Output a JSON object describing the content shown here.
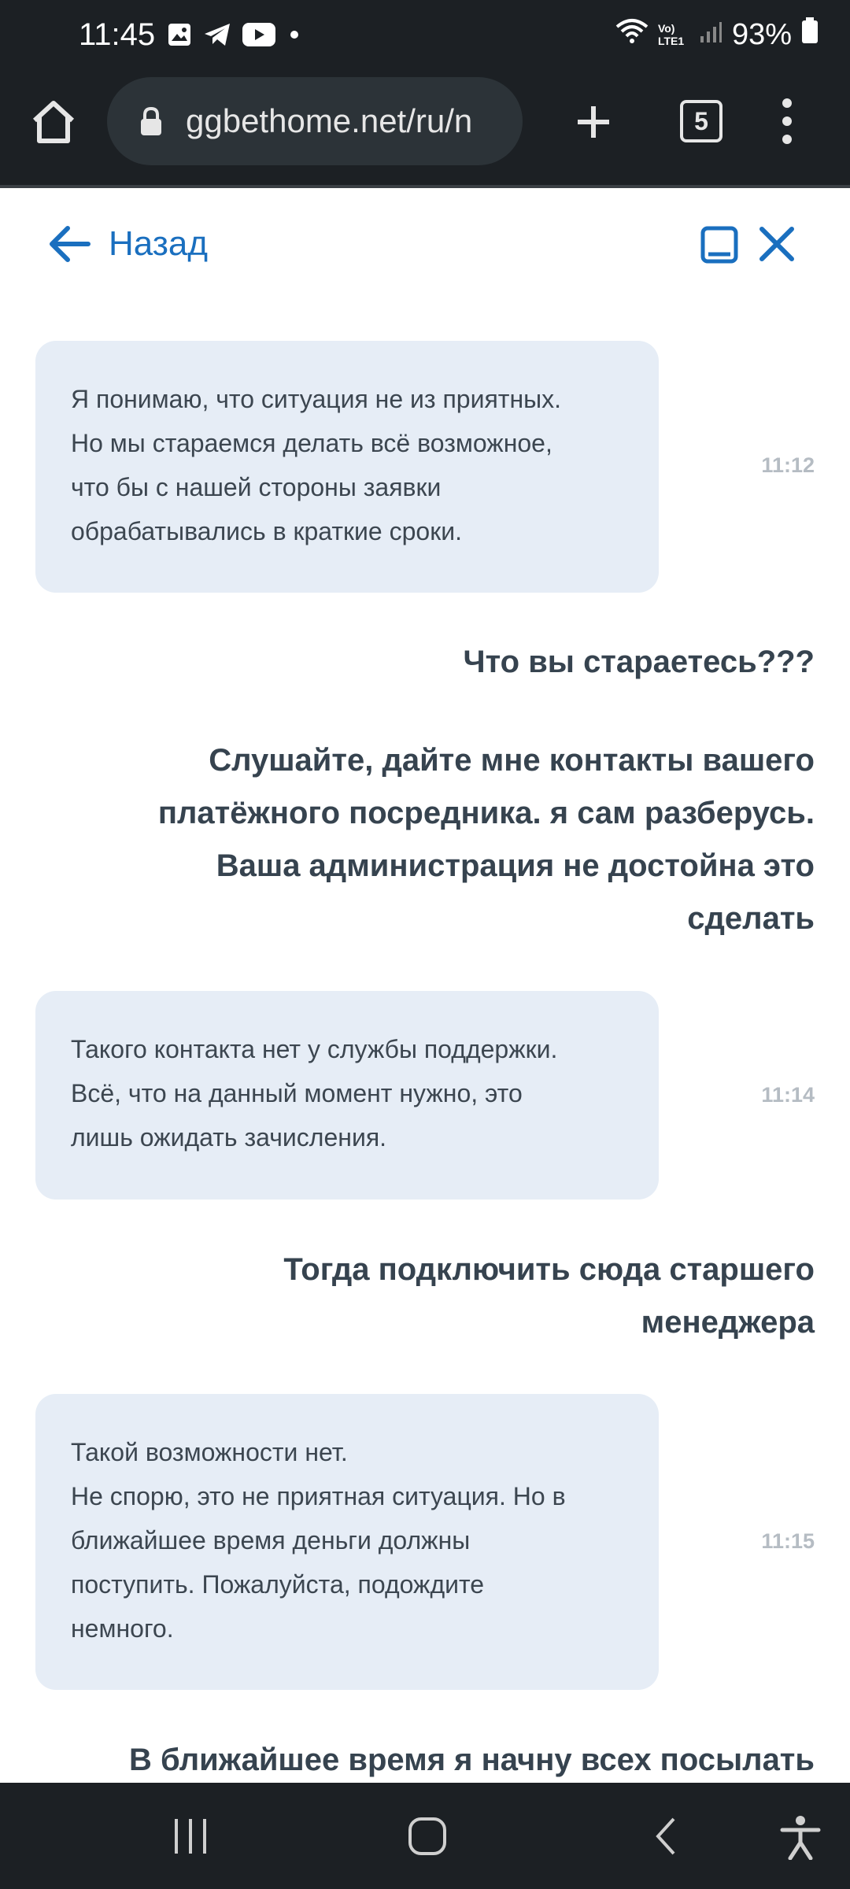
{
  "status_bar": {
    "time": "11:45",
    "battery": "93%",
    "lte_label": "Vo) LTE1",
    "icons": [
      "gallery-icon",
      "telegram-icon",
      "youtube-icon",
      "dot-icon",
      "wifi-icon",
      "signal-icon",
      "battery-icon"
    ]
  },
  "browser": {
    "url": "ggbethome.net/ru/n",
    "tab_count": "5"
  },
  "chat_header": {
    "back_label": "Назад"
  },
  "messages": [
    {
      "type": "support",
      "lines": [
        "Я понимаю, что ситуация не из приятных.",
        "Но мы стараемся делать всё возможное,",
        "что бы с нашей стороны заявки",
        "обрабатывались в краткие сроки."
      ],
      "time": "11:12"
    },
    {
      "type": "user",
      "text": "Что вы стараетесь???"
    },
    {
      "type": "user",
      "text": "Слушайте,  дайте мне контакты вашего\nплатёжного посредника. я сам разберусь.\nВаша администрация не достойна это\nсделать"
    },
    {
      "type": "support",
      "lines": [
        "Такого контакта нет у службы поддержки.",
        "Всё, что на данный момент нужно, это",
        "лишь ожидать зачисления."
      ],
      "time": "11:14"
    },
    {
      "type": "user",
      "text": "Тогда подключить сюда старшего\nменеджера"
    },
    {
      "type": "support",
      "lines": [
        "Такой возможности нет.",
        "Не спорю, это не приятная ситуация. Но в",
        "ближайшее время деньги должны",
        "поступить. Пожалуйста, подождите",
        "немного."
      ],
      "time": "11:15"
    },
    {
      "type": "user",
      "text": "В ближайшее время я начну всех посылать"
    }
  ],
  "colors": {
    "accent": "#1a6fbf",
    "support_bubble": "#e6edf6",
    "user_text": "#36434f",
    "chrome": "#1c2024"
  }
}
